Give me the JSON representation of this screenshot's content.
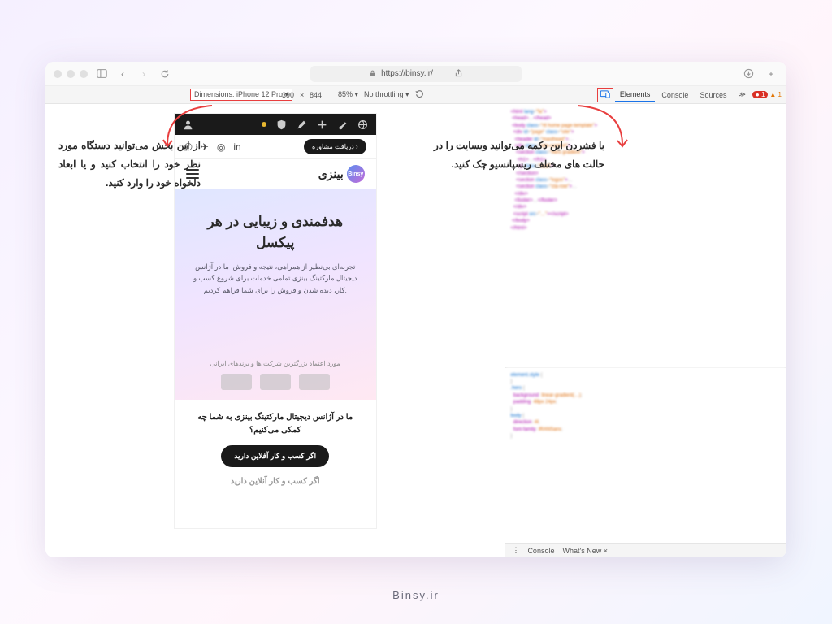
{
  "browser": {
    "url": "https://binsy.ir/"
  },
  "devtools": {
    "dimensions_label": "Dimensions: iPhone 12 Pro ▾",
    "width": "390",
    "x": "×",
    "height": "844",
    "zoom": "85% ▾",
    "throttling": "No throttling ▾",
    "tabs": {
      "elements": "Elements",
      "console": "Console",
      "sources": "Sources",
      "more": "≫"
    },
    "errors": "1",
    "warnings": "1",
    "bottom_tabs": {
      "console": "Console",
      "whatsnew": "What's New ×"
    }
  },
  "callouts": {
    "left": "از این بخش می‌توانید دستگاه مورد نظر خود را انتخاب کنید و یا ابعاد دلخواه خود را وارد کنید.",
    "right": "با فشردن این دکمه می‌توانید وبسایت را در حالت های مختلف ریسپانسیو چک کنید."
  },
  "mobile": {
    "cta": "دریافت مشاوره ›",
    "brand": "بینزی",
    "brand_badge": "Binsy",
    "hero_title": "هدفمندی و زیبایی در هر پیکسل",
    "hero_desc": "تجربه‌ای بی‌نظیر از همراهی، نتیجه و فروش. ما در آژانس دیجیتال مارکتینگ بینزی تمامی خدمات برای شروع کسب و کار، دیده شدن و فروش را برای شما فراهم کردیم.",
    "trusted": "مورد اعتماد بزرگترین شرکت ها و برندهای ایرانی",
    "help_title": "ما در آژانس دیجیتال مارکتینگ بینزی به شما چه کمکی می‌کنیم؟",
    "offline_btn": "اگر کسب و کار آفلاین دارید",
    "online_heading": "اگر کسب و کار آنلاین دارید"
  },
  "footer": "Binsy.ir"
}
